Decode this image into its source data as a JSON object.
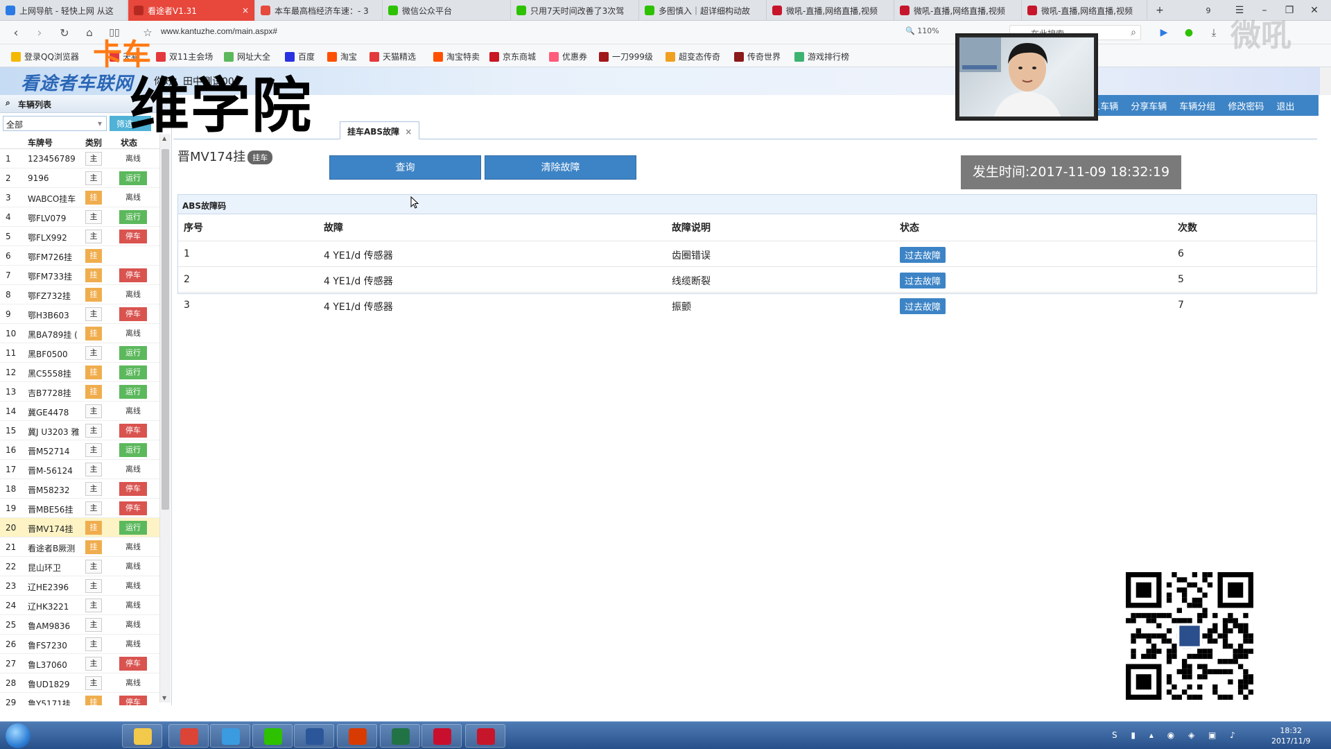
{
  "browser": {
    "tabs": [
      {
        "label": "上网导航 - 轻快上网 从这",
        "color": "#2c7be5",
        "active": false
      },
      {
        "label": "看途者V1.31",
        "color": "#ffffff",
        "active": true
      },
      {
        "label": "本车最高档经济车速：- 3",
        "color": "#e64a3b",
        "active": false
      },
      {
        "label": "微信公众平台",
        "color": "#2dc100",
        "active": false
      },
      {
        "label": "只用7天时间改善了3次驾",
        "color": "#2dc100",
        "active": false
      },
      {
        "label": "多图慎入｜超详细构动故",
        "color": "#2dc100",
        "active": false
      },
      {
        "label": "微吼-直播,网络直播,视频",
        "color": "#c7162b",
        "active": false
      },
      {
        "label": "微吼-直播,网络直播,视频",
        "color": "#c7162b",
        "active": false
      },
      {
        "label": "微吼-直播,网络直播,视频",
        "color": "#c7162b",
        "active": false
      }
    ],
    "tab_count": "9",
    "url": "www.kantuzhe.com/main.aspx#",
    "zoom": "110%",
    "search_placeholder": "在此搜索",
    "bookmarks": [
      {
        "label": "登录QQ浏览器",
        "color": "#f5b800"
      },
      {
        "label": "天猫",
        "color": "#e4393c"
      },
      {
        "label": "双11主会场",
        "color": "#e4393c"
      },
      {
        "label": "网址大全",
        "color": "#5cb85c"
      },
      {
        "label": "百度",
        "color": "#2932e1"
      },
      {
        "label": "淘宝",
        "color": "#ff5000"
      },
      {
        "label": "天猫精选",
        "color": "#e4393c"
      },
      {
        "label": "淘宝特卖",
        "color": "#ff5000"
      },
      {
        "label": "京东商城",
        "color": "#c81623"
      },
      {
        "label": "优惠券",
        "color": "#ff5b7a"
      },
      {
        "label": "一刀999级",
        "color": "#a0171b"
      },
      {
        "label": "超变态传奇",
        "color": "#f0a020"
      },
      {
        "label": "传奇世界",
        "color": "#8b1a1a"
      },
      {
        "label": "游戏排行榜",
        "color": "#3cb371"
      }
    ]
  },
  "overlay": {
    "brand_small": "卡车",
    "brand_big": "维学院",
    "watermark": "微吼"
  },
  "app": {
    "logo": "看途者车联网",
    "greeting": "你好：田中测试001",
    "top_nav": [
      "1车辆",
      "分享车辆",
      "车辆分组",
      "修改密码",
      "退出"
    ],
    "sidebar_title": "车辆列表",
    "filter_select": "全部",
    "filter_button": "筛选",
    "columns": {
      "type": "类别",
      "plate": "车牌号",
      "status": "状态"
    },
    "vehicles": [
      {
        "n": "1",
        "plate": "123456789",
        "type": "主",
        "gua": false,
        "status": "离线",
        "s": "off"
      },
      {
        "n": "2",
        "plate": "9196",
        "type": "主",
        "gua": false,
        "status": "运行",
        "s": "run"
      },
      {
        "n": "3",
        "plate": "WABCO挂车",
        "type": "挂",
        "gua": true,
        "status": "离线",
        "s": "off"
      },
      {
        "n": "4",
        "plate": "鄂FLV079",
        "type": "主",
        "gua": false,
        "status": "运行",
        "s": "run"
      },
      {
        "n": "5",
        "plate": "鄂FLX992",
        "type": "主",
        "gua": false,
        "status": "停车",
        "s": "stop"
      },
      {
        "n": "6",
        "plate": "鄂FM726挂",
        "type": "挂",
        "gua": true,
        "status": "",
        "s": "none"
      },
      {
        "n": "7",
        "plate": "鄂FM733挂",
        "type": "挂",
        "gua": true,
        "status": "停车",
        "s": "stop"
      },
      {
        "n": "8",
        "plate": "鄂FZ732挂",
        "type": "挂",
        "gua": true,
        "status": "离线",
        "s": "off"
      },
      {
        "n": "9",
        "plate": "鄂H3B603",
        "type": "主",
        "gua": false,
        "status": "停车",
        "s": "stop"
      },
      {
        "n": "10",
        "plate": "黑BA789挂 (",
        "type": "挂",
        "gua": true,
        "status": "离线",
        "s": "off"
      },
      {
        "n": "11",
        "plate": "黑BF0500",
        "type": "主",
        "gua": false,
        "status": "运行",
        "s": "run"
      },
      {
        "n": "12",
        "plate": "黑C5558挂",
        "type": "挂",
        "gua": true,
        "status": "运行",
        "s": "run"
      },
      {
        "n": "13",
        "plate": "吉B7728挂",
        "type": "挂",
        "gua": true,
        "status": "运行",
        "s": "run"
      },
      {
        "n": "14",
        "plate": "冀GE4478",
        "type": "主",
        "gua": false,
        "status": "离线",
        "s": "off"
      },
      {
        "n": "15",
        "plate": "冀J U3203 雅",
        "type": "主",
        "gua": false,
        "status": "停车",
        "s": "stop"
      },
      {
        "n": "16",
        "plate": "晋M52714",
        "type": "主",
        "gua": false,
        "status": "运行",
        "s": "run"
      },
      {
        "n": "17",
        "plate": "晋M-56124",
        "type": "主",
        "gua": false,
        "status": "离线",
        "s": "off"
      },
      {
        "n": "18",
        "plate": "晋M58232",
        "type": "主",
        "gua": false,
        "status": "停车",
        "s": "stop"
      },
      {
        "n": "19",
        "plate": "晋MBE56挂",
        "type": "主",
        "gua": false,
        "status": "停车",
        "s": "stop"
      },
      {
        "n": "20",
        "plate": "晋MV174挂",
        "type": "挂",
        "gua": true,
        "status": "运行",
        "s": "run",
        "selected": true
      },
      {
        "n": "21",
        "plate": "看途者B厥测",
        "type": "挂",
        "gua": true,
        "status": "离线",
        "s": "off"
      },
      {
        "n": "22",
        "plate": "昆山环卫",
        "type": "主",
        "gua": false,
        "status": "离线",
        "s": "off"
      },
      {
        "n": "23",
        "plate": "辽HE2396",
        "type": "主",
        "gua": false,
        "status": "离线",
        "s": "off"
      },
      {
        "n": "24",
        "plate": "辽HK3221",
        "type": "主",
        "gua": false,
        "status": "离线",
        "s": "off"
      },
      {
        "n": "25",
        "plate": "鲁AM9836",
        "type": "主",
        "gua": false,
        "status": "离线",
        "s": "off"
      },
      {
        "n": "26",
        "plate": "鲁FS7230",
        "type": "主",
        "gua": false,
        "status": "离线",
        "s": "off"
      },
      {
        "n": "27",
        "plate": "鲁L37060",
        "type": "主",
        "gua": false,
        "status": "停车",
        "s": "stop"
      },
      {
        "n": "28",
        "plate": "鲁UD1829",
        "type": "主",
        "gua": false,
        "status": "离线",
        "s": "off"
      },
      {
        "n": "29",
        "plate": "鲁Y5171挂",
        "type": "挂",
        "gua": true,
        "status": "停车",
        "s": "stop"
      }
    ],
    "content_tab": "挂车ABS故障",
    "vehicle_plate": "晋MV174挂",
    "vehicle_badge": "挂车",
    "query_button": "查询",
    "clear_button": "清除故障",
    "occur_time": "发生时间:2017-11-09 18:32:19",
    "panel_title": "ABS故障码",
    "fault_headers": [
      "序号",
      "故障",
      "故障说明",
      "状态",
      "次数"
    ],
    "faults": [
      {
        "n": "1",
        "fault": "4 YE1/d 传感器",
        "desc": "齿圈错误",
        "status": "过去故障",
        "count": "6"
      },
      {
        "n": "2",
        "fault": "4 YE1/d 传感器",
        "desc": "线缆断裂",
        "status": "过去故障",
        "count": "5"
      },
      {
        "n": "3",
        "fault": "4 YE1/d 传感器",
        "desc": "振颤",
        "status": "过去故障",
        "count": "7"
      }
    ]
  },
  "taskbar": {
    "apps": [
      {
        "name": "explorer",
        "color": "#f3c94b"
      },
      {
        "name": "chrome",
        "color": "#db4437"
      },
      {
        "name": "ie",
        "color": "#3a9be0"
      },
      {
        "name": "wechat",
        "color": "#2dc100"
      },
      {
        "name": "word",
        "color": "#2b579a"
      },
      {
        "name": "reader",
        "color": "#d83b01"
      },
      {
        "name": "excel",
        "color": "#217346"
      },
      {
        "name": "acrobat",
        "color": "#c8102e"
      },
      {
        "name": "vhall",
        "color": "#c7162b"
      }
    ],
    "time": "18:32",
    "date": "2017/11/9"
  }
}
